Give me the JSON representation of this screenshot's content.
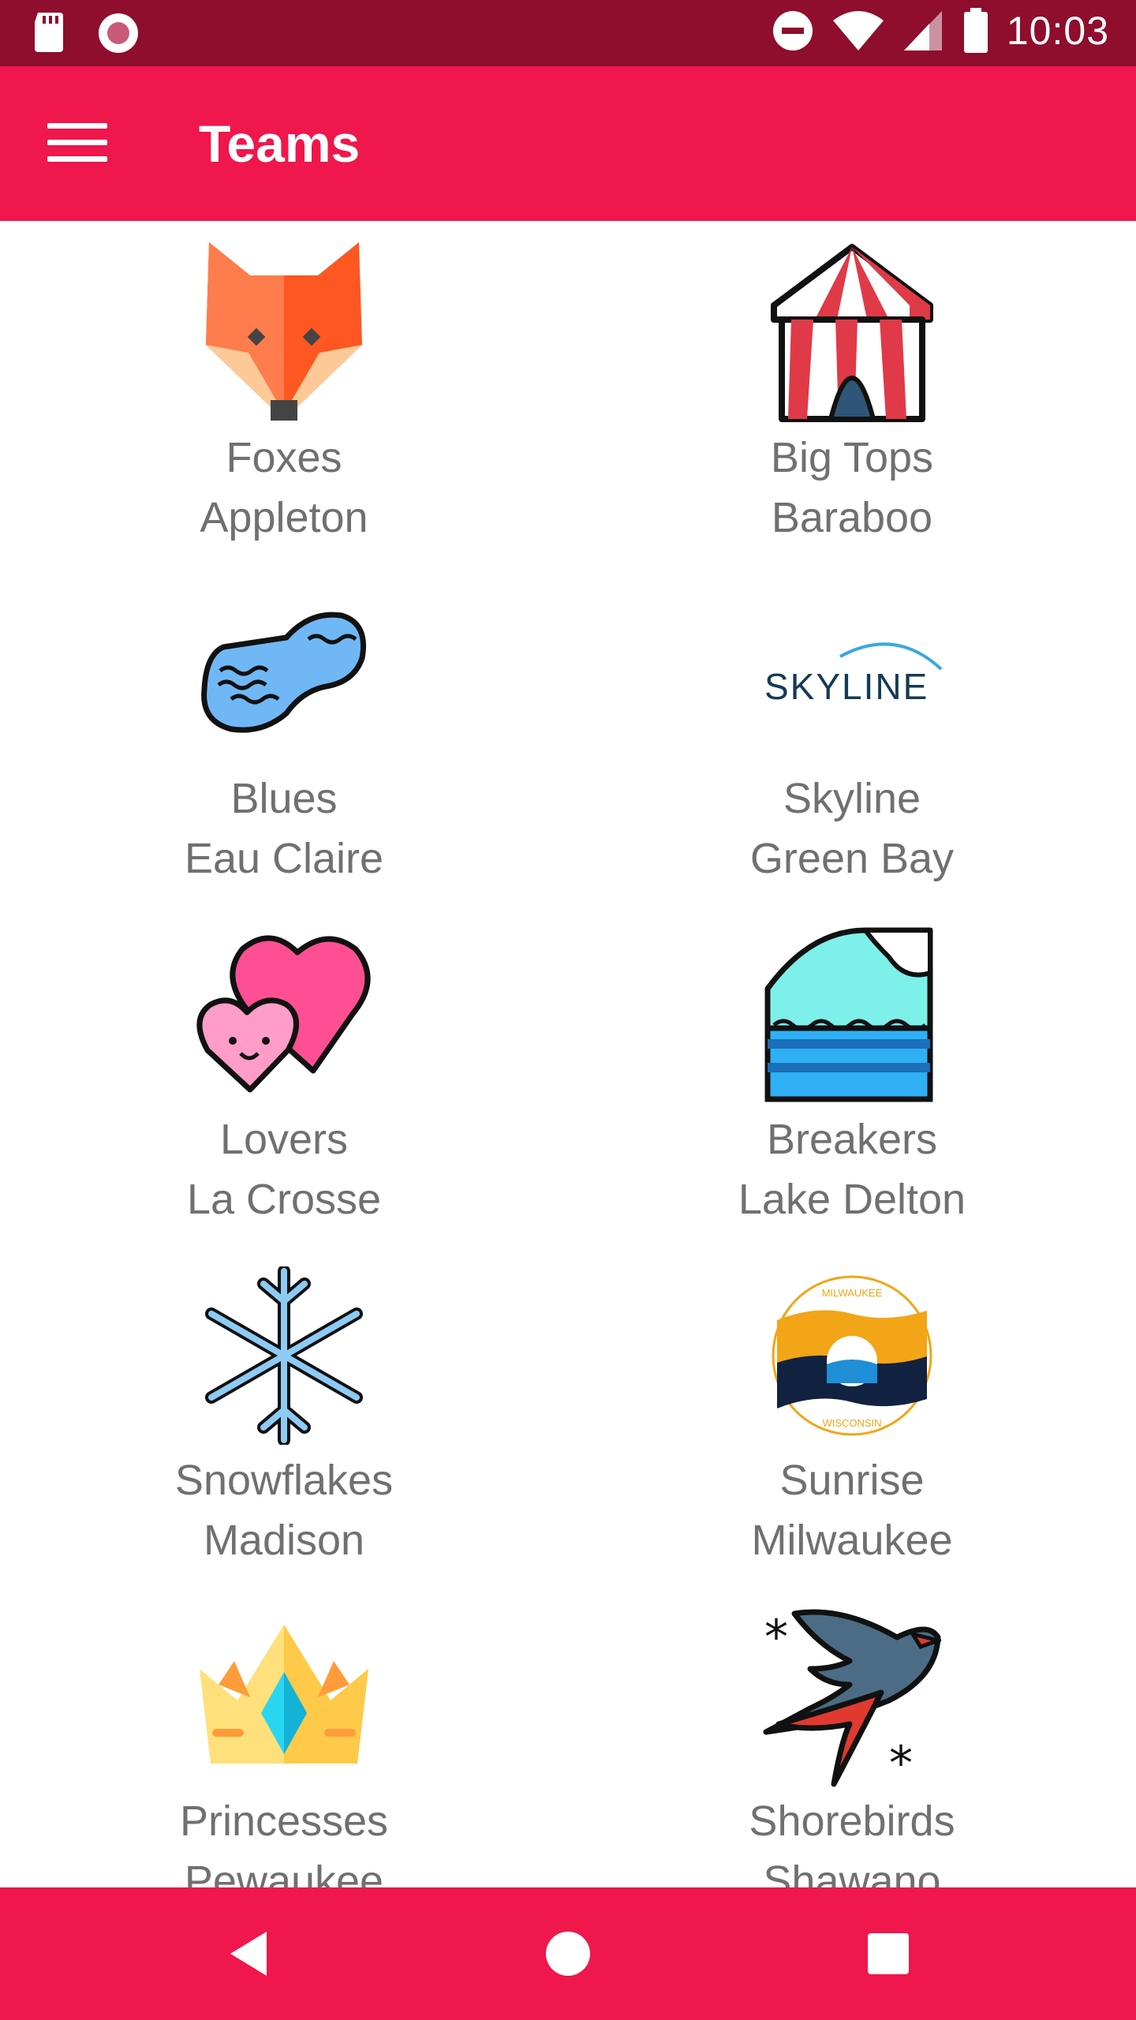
{
  "status_bar": {
    "time": "10:03",
    "left_icons": [
      "sd-card-icon",
      "record-icon"
    ],
    "right_icons": [
      "do-not-disturb-icon",
      "wifi-icon",
      "signal-icon",
      "battery-icon"
    ]
  },
  "app_bar": {
    "title": "Teams",
    "menu_icon": "menu-icon"
  },
  "teams": [
    {
      "name": "Foxes",
      "city": "Appleton",
      "icon": "fox-icon"
    },
    {
      "name": "Big Tops",
      "city": "Baraboo",
      "icon": "circus-tent-icon"
    },
    {
      "name": "Blues",
      "city": "Eau Claire",
      "icon": "lake-icon"
    },
    {
      "name": "Skyline",
      "city": "Green Bay",
      "icon": "skyline-logo",
      "logo_text": "SKYLINE"
    },
    {
      "name": "Lovers",
      "city": "La Crosse",
      "icon": "hearts-icon"
    },
    {
      "name": "Breakers",
      "city": "Lake Delton",
      "icon": "wave-icon"
    },
    {
      "name": "Snowflakes",
      "city": "Madison",
      "icon": "snowflake-icon"
    },
    {
      "name": "Sunrise",
      "city": "Milwaukee",
      "icon": "milwaukee-flag-logo",
      "logo_text_top": "MILWAUKEE",
      "logo_text_bottom": "WISCONSIN"
    },
    {
      "name": "Princesses",
      "city": "Pewaukee",
      "icon": "crown-icon"
    },
    {
      "name": "Shorebirds",
      "city": "Shawano",
      "icon": "swallow-icon"
    }
  ],
  "nav_bar": {
    "back_icon": "back-icon",
    "home_icon": "home-icon",
    "recents_icon": "recents-icon"
  },
  "colors": {
    "status_bar": "#8f0d2d",
    "primary": "#ef174b",
    "label_text": "#707070"
  }
}
